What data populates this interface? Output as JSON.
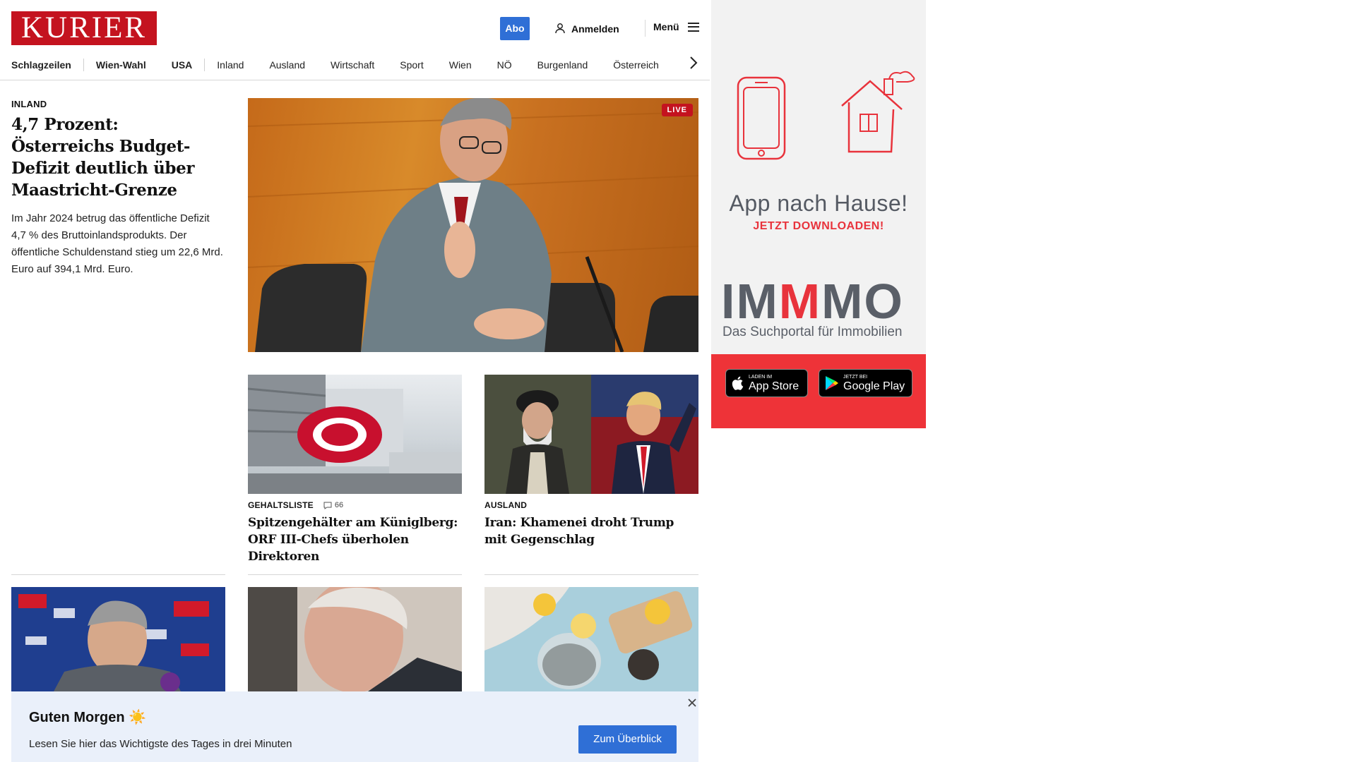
{
  "header": {
    "logo": "KURIER",
    "abo_label": "Abo",
    "login_label": "Anmelden",
    "menu_label": "Menü"
  },
  "nav": {
    "items": [
      "Schlagzeilen",
      "Wien-Wahl",
      "USA",
      "Inland",
      "Ausland",
      "Wirtschaft",
      "Sport",
      "Wien",
      "NÖ",
      "Burgenland",
      "Österreich"
    ]
  },
  "lead": {
    "kicker": "INLAND",
    "title": "4,7 Prozent: Österreichs Budget-Defizit deutlich über Maastricht-Grenze",
    "body": "Im Jahr 2024 betrug das öffentliche Defizit 4,7 % des Bruttoinlandsprodukts. Der öffentliche Schuldenstand stieg um 22,6 Mrd. Euro auf 394,1 Mrd. Euro.",
    "live_label": "LIVE"
  },
  "cards": [
    {
      "kicker": "GEHALTSLISTE",
      "comments": "66",
      "title": "Spitzengehälter am Küniglberg: ORF III-Chefs überholen Direktoren"
    },
    {
      "kicker": "AUSLAND",
      "title": "Iran: Khamenei droht Trump mit Gegenschlag"
    }
  ],
  "banner": {
    "title": "Guten Morgen ☀️",
    "subtitle": "Lesen Sie hier das Wichtigste des Tages in drei Minuten",
    "button": "Zum Überblick"
  },
  "ad": {
    "headline": "App nach Hause!",
    "cta": "JETZT DOWNLOADEN!",
    "brand_a": "IM",
    "brand_b": "M",
    "brand_c": "MO",
    "tagline": "Das Suchportal für Immobilien",
    "appstore_small": "Laden im",
    "appstore_big": "App Store",
    "googleplay_small": "JETZT BEI",
    "googleplay_big": "Google Play"
  },
  "colors": {
    "brand_red": "#c4131f",
    "accent_blue": "#2f6fd6",
    "ad_red": "#ee3338"
  }
}
